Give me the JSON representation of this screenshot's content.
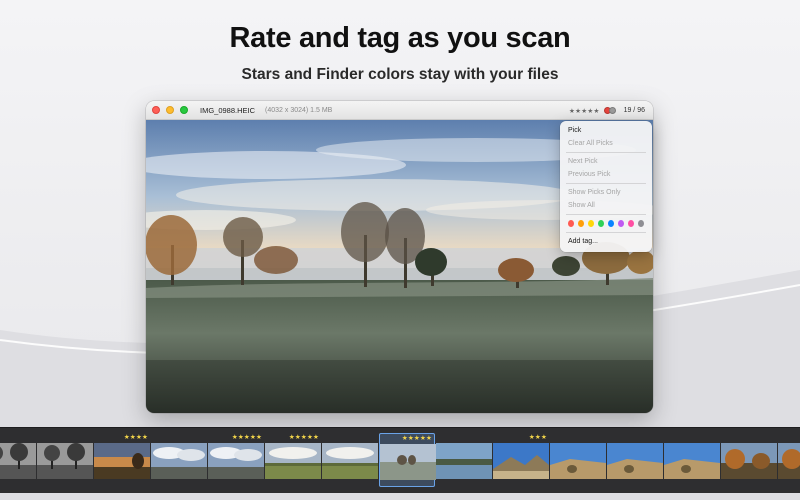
{
  "hero": {
    "headline": "Rate and tag as you scan",
    "subline": "Stars and Finder colors stay with your files"
  },
  "window": {
    "filename": "IMG_0988.HEIC",
    "fileinfo": "(4032 x 3024) 1.5 MB",
    "rating_stars": "★★★★★",
    "counter": "19 / 96",
    "tag_colors": [
      "#e5443d",
      "#9a9a9a"
    ]
  },
  "context_menu": {
    "items": [
      {
        "label": "Pick",
        "enabled": true
      },
      {
        "label": "Clear All Picks",
        "enabled": false
      },
      {
        "label": "Next Pick",
        "enabled": false
      },
      {
        "label": "Previous Pick",
        "enabled": false
      },
      {
        "label": "Show Picks Only",
        "enabled": false
      },
      {
        "label": "Show All",
        "enabled": false
      },
      {
        "label": "Add tag...",
        "enabled": true
      }
    ],
    "colors": [
      "#ff5a52",
      "#ff9f0a",
      "#ffd60a",
      "#30d158",
      "#0a84ff",
      "#bf5af2",
      "#ff4fa3",
      "#8e8e93"
    ]
  },
  "filmstrip": {
    "thumbs": [
      {
        "stars": "",
        "scene": "bw"
      },
      {
        "stars": "",
        "scene": "bw"
      },
      {
        "stars": "★★★★",
        "scene": "sunset"
      },
      {
        "stars": "",
        "scene": "cloud"
      },
      {
        "stars": "★★★★★",
        "scene": "cloud"
      },
      {
        "stars": "★★★★★",
        "scene": "field"
      },
      {
        "stars": "",
        "scene": "field"
      },
      {
        "stars": "★★★★★",
        "scene": "frost",
        "selected": true
      },
      {
        "stars": "",
        "scene": "lake"
      },
      {
        "stars": "★★★",
        "scene": "mountain"
      },
      {
        "stars": "",
        "scene": "desert"
      },
      {
        "stars": "",
        "scene": "desert"
      },
      {
        "stars": "",
        "scene": "desert"
      },
      {
        "stars": "",
        "scene": "autumn"
      },
      {
        "stars": "★",
        "scene": "autumn"
      }
    ]
  }
}
